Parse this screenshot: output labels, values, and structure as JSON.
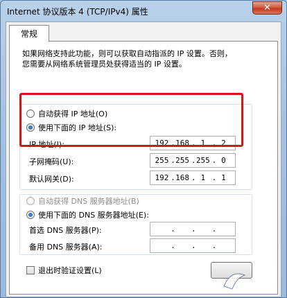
{
  "window": {
    "title": "Internet 协议版本 4 (TCP/IPv4) 属性",
    "close_label": "✕"
  },
  "tabs": [
    {
      "label": "常规",
      "active": true
    }
  ],
  "description": {
    "line1": "如果网络支持此功能，则可以获取自动指派的 IP 设置。否则，",
    "line2": "您需要从网络系统管理员处获得适当的 IP 设置。"
  },
  "ip_section": {
    "auto_label": "自动获得 IP 地址(O)",
    "auto_selected": false,
    "manual_label": "使用下面的 IP 地址(S):",
    "manual_selected": true,
    "fields": [
      {
        "label": "IP 地址(I):",
        "octets": [
          "192",
          "168",
          "1",
          "2"
        ]
      },
      {
        "label": "子网掩码(U):",
        "octets": [
          "255",
          "255",
          "255",
          "0"
        ]
      },
      {
        "label": "默认网关(D):",
        "octets": [
          "192",
          "168",
          "1",
          "1"
        ]
      }
    ]
  },
  "dns_section": {
    "auto_label": "自动获得 DNS 服务器地址(B)",
    "auto_selected": false,
    "auto_disabled": true,
    "manual_label": "使用下面的 DNS 服务器地址(E):",
    "manual_selected": true,
    "fields": [
      {
        "label": "首选 DNS 服务器(P):",
        "octets": [
          "",
          "",
          "",
          ""
        ]
      },
      {
        "label": "备用 DNS 服务器(A):",
        "octets": [
          "",
          "",
          "",
          ""
        ]
      }
    ]
  },
  "validate_on_exit": {
    "label": "退出时验证设置(L)",
    "checked": false
  },
  "colors": {
    "highlight_frame": "#cc1a1a",
    "close_button": "#c0391f"
  }
}
